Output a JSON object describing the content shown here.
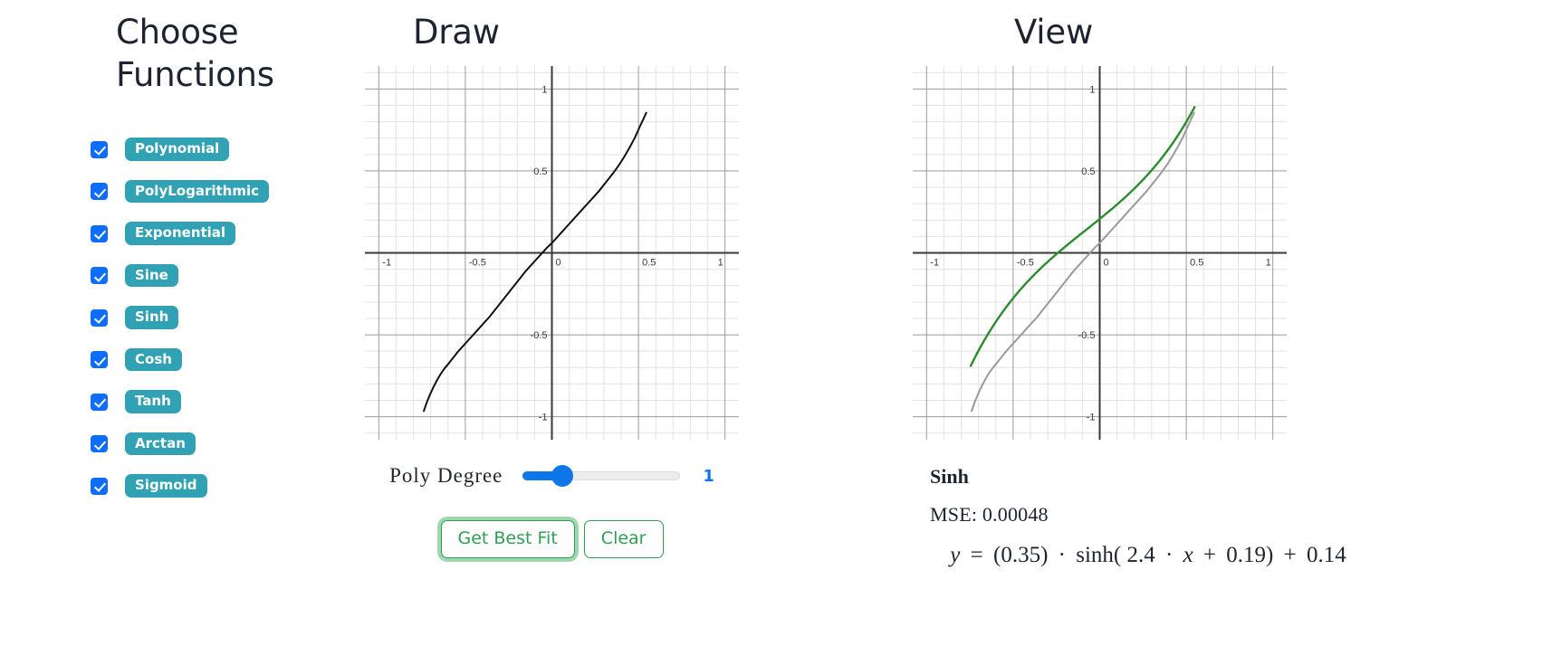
{
  "columns": {
    "choose": {
      "title": "Choose Functions"
    },
    "draw": {
      "title": "Draw"
    },
    "view": {
      "title": "View"
    }
  },
  "functions": {
    "items": [
      {
        "label": "Polynomial",
        "checked": true
      },
      {
        "label": "PolyLogarithmic",
        "checked": true
      },
      {
        "label": "Exponential",
        "checked": true
      },
      {
        "label": "Sine",
        "checked": true
      },
      {
        "label": "Sinh",
        "checked": true
      },
      {
        "label": "Cosh",
        "checked": true
      },
      {
        "label": "Tanh",
        "checked": true
      },
      {
        "label": "Arctan",
        "checked": true
      },
      {
        "label": "Sigmoid",
        "checked": true
      }
    ],
    "badge_color": "#31a1b4",
    "checkbox_color": "#0d6efd"
  },
  "controls": {
    "slider_label": "Poly Degree",
    "slider_value": "1",
    "slider_min": 1,
    "slider_max": 6,
    "slider_value_color": "#1273e6",
    "slider_accent": "#0d76e8",
    "get_best_fit_label": "Get Best Fit",
    "clear_label": "Clear",
    "button_color": "#2f9e52"
  },
  "results": {
    "function_name": "Sinh",
    "mse_label": "MSE: 0.00048",
    "equation": {
      "lhs": "y",
      "eq": "=",
      "amplitude": "(0.35)",
      "dot1": "·",
      "func": "sinh(",
      "freq": "2.4",
      "dot2": "·",
      "variable": "x",
      "plus1": "+",
      "phase": "0.19)",
      "plus2": "+",
      "offset": "0.14",
      "plain": "y = (0.35) · sinh(2.4 · x + 0.19) + 0.14"
    }
  },
  "chart_data": [
    {
      "id": "draw",
      "type": "line",
      "title": "Draw",
      "xlabel": "",
      "ylabel": "",
      "xlim": [
        -1.08,
        1.08
      ],
      "ylim": [
        -1.14,
        1.14
      ],
      "grid": true,
      "minor_grid_step": 0.1,
      "major_grid_step": 0.5,
      "xticks": [
        -1,
        -0.5,
        0,
        0.5,
        1
      ],
      "xticklabels": [
        "-1",
        "-0.5",
        "0",
        "0.5",
        "1"
      ],
      "yticks": [
        -1,
        -0.5,
        0.5,
        1
      ],
      "yticklabels": [
        "-1",
        "-0.5",
        "0.5",
        "1"
      ],
      "legend": "none",
      "series": [
        {
          "name": "user-drawn curve",
          "color": "#111111",
          "x": [
            -0.74,
            -0.72,
            -0.7,
            -0.68,
            -0.66,
            -0.64,
            -0.62,
            -0.6,
            -0.57,
            -0.54,
            -0.51,
            -0.48,
            -0.45,
            -0.42,
            -0.39,
            -0.36,
            -0.33,
            -0.3,
            -0.27,
            -0.24,
            -0.21,
            -0.18,
            -0.15,
            -0.12,
            -0.09,
            -0.06,
            -0.03,
            0.0,
            0.03,
            0.06,
            0.09,
            0.12,
            0.15,
            0.18,
            0.21,
            0.24,
            0.27,
            0.3,
            0.33,
            0.36,
            0.39,
            0.42,
            0.45,
            0.48,
            0.51,
            0.53,
            0.545
          ],
          "y": [
            -0.965,
            -0.905,
            -0.855,
            -0.81,
            -0.77,
            -0.735,
            -0.705,
            -0.68,
            -0.64,
            -0.6,
            -0.565,
            -0.53,
            -0.495,
            -0.46,
            -0.425,
            -0.39,
            -0.35,
            -0.31,
            -0.27,
            -0.23,
            -0.19,
            -0.15,
            -0.11,
            -0.075,
            -0.04,
            -0.005,
            0.03,
            0.06,
            0.095,
            0.13,
            0.165,
            0.2,
            0.235,
            0.27,
            0.305,
            0.34,
            0.375,
            0.415,
            0.455,
            0.495,
            0.54,
            0.59,
            0.645,
            0.705,
            0.775,
            0.82,
            0.855
          ]
        }
      ]
    },
    {
      "id": "view",
      "type": "line",
      "title": "View",
      "xlabel": "",
      "ylabel": "",
      "xlim": [
        -1.08,
        1.08
      ],
      "ylim": [
        -1.14,
        1.14
      ],
      "grid": true,
      "minor_grid_step": 0.1,
      "major_grid_step": 0.5,
      "xticks": [
        -1,
        -0.5,
        0,
        0.5,
        1
      ],
      "xticklabels": [
        "-1",
        "-0.5",
        "0",
        "0.5",
        "1"
      ],
      "yticks": [
        -1,
        -0.5,
        0.5,
        1
      ],
      "yticklabels": [
        "-1",
        "-0.5",
        "0.5",
        "1"
      ],
      "legend": "none",
      "series": [
        {
          "name": "original drawn curve",
          "color": "#9a9a9a",
          "x": [
            -0.74,
            -0.72,
            -0.7,
            -0.68,
            -0.66,
            -0.64,
            -0.62,
            -0.6,
            -0.57,
            -0.54,
            -0.51,
            -0.48,
            -0.45,
            -0.42,
            -0.39,
            -0.36,
            -0.33,
            -0.3,
            -0.27,
            -0.24,
            -0.21,
            -0.18,
            -0.15,
            -0.12,
            -0.09,
            -0.06,
            -0.03,
            0.0,
            0.03,
            0.06,
            0.09,
            0.12,
            0.15,
            0.18,
            0.21,
            0.24,
            0.27,
            0.3,
            0.33,
            0.36,
            0.39,
            0.42,
            0.45,
            0.48,
            0.51,
            0.53,
            0.545
          ],
          "y": [
            -0.965,
            -0.905,
            -0.855,
            -0.81,
            -0.77,
            -0.735,
            -0.705,
            -0.68,
            -0.64,
            -0.6,
            -0.565,
            -0.53,
            -0.495,
            -0.46,
            -0.425,
            -0.39,
            -0.35,
            -0.31,
            -0.27,
            -0.23,
            -0.19,
            -0.15,
            -0.11,
            -0.075,
            -0.04,
            -0.005,
            0.03,
            0.06,
            0.095,
            0.13,
            0.165,
            0.2,
            0.235,
            0.27,
            0.305,
            0.34,
            0.375,
            0.415,
            0.455,
            0.495,
            0.54,
            0.59,
            0.645,
            0.705,
            0.775,
            0.82,
            0.855
          ]
        },
        {
          "name": "fitted Sinh curve",
          "color": "#2e8b2e",
          "formula": "y = (0.35) * sinh(2.4 * x + 0.19) + 0.14",
          "params": {
            "a": 0.35,
            "b": 2.4,
            "c": 0.19,
            "d": 0.14
          },
          "x_start": -0.745,
          "x_end": 0.548
        }
      ]
    }
  ]
}
